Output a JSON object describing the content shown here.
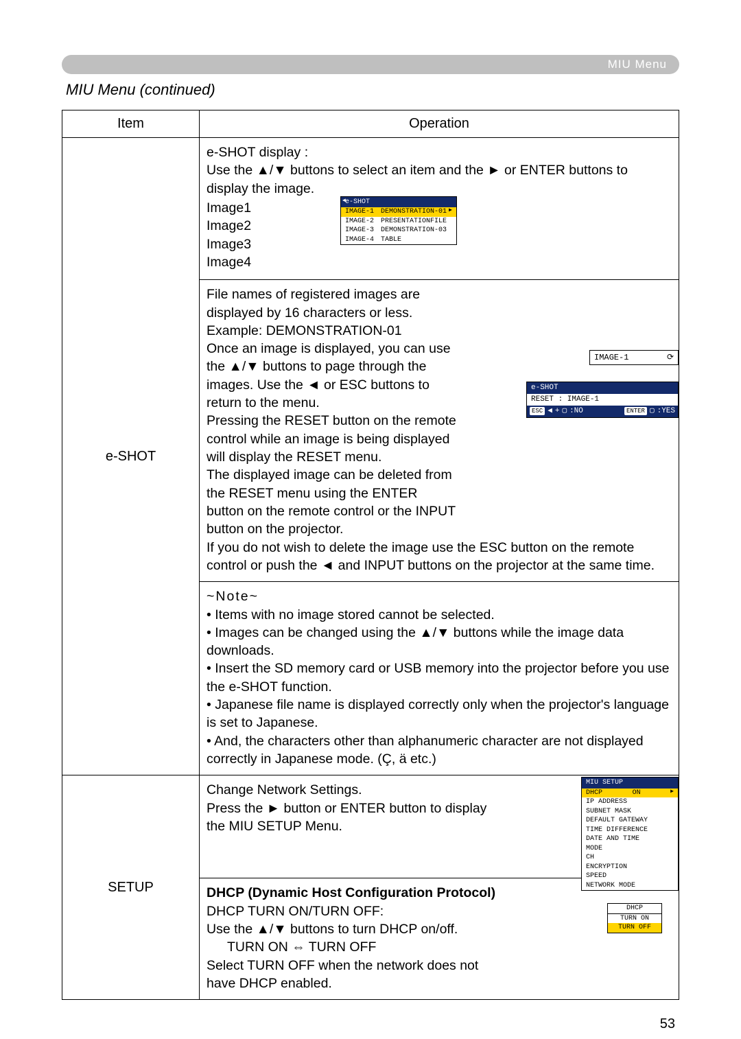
{
  "header": {
    "title": "MIU Menu"
  },
  "continued": "MIU Menu (continued)",
  "table": {
    "headers": {
      "item": "Item",
      "operation": "Operation"
    },
    "rows": {
      "eshot": {
        "item": "e-SHOT",
        "section1": {
          "title": "e-SHOT display :",
          "intro": "Use the ▲/▼ buttons to select an item and the ► or ENTER buttons to display the image.",
          "images": {
            "i1": "Image1",
            "i2": "Image2",
            "i3": "Image3",
            "i4": "Image4"
          },
          "menu": {
            "title": "e-SHOT",
            "r1l": "IMAGE-1",
            "r1r": "DEMONSTRATION-01",
            "r2l": "IMAGE-2",
            "r2r": "PRESENTATIONFILE",
            "r3l": "IMAGE-3",
            "r3r": "DEMONSTRATION-03",
            "r4l": "IMAGE-4",
            "r4r": "TABLE"
          }
        },
        "section2": {
          "para": "File names of registered images are displayed by 16 characters or less. Example: DEMONSTRATION-01\nOnce an image is displayed, you can use the ▲/▼ buttons to page through the images. Use the ◄ or ESC buttons to return to the menu.\nPressing the RESET button on the remote control while an image is being displayed will display the RESET menu.\nThe displayed image can be deleted from the RESET menu using the ENTER button on the remote control or the INPUT button on the projector.\nIf you do not wish to delete the image use the ESC button on the remote control or push the ◄ and INPUT buttons on the projector at the same time.",
          "image1_label": "IMAGE-1",
          "reset": {
            "t": "e-SHOT",
            "r": "RESET : IMAGE-1",
            "esc": "ESC",
            "no": ":NO",
            "enter": "ENTER",
            "yes": ":YES"
          }
        },
        "section3": {
          "heading": "~Note~",
          "b1": "• Items with no image stored cannot be selected.",
          "b2": "• Images can be changed using the ▲/▼ buttons while the image data downloads.",
          "b3": "• Insert the SD memory card or USB memory into the projector before you use the e-SHOT function.",
          "b4": "• Japanese file name is displayed correctly only when the projector's language is set to Japanese.",
          "b5": "• And, the characters other than alphanumeric character are not displayed correctly in Japanese mode. (Ç, ä etc.)"
        }
      },
      "setup": {
        "item": "SETUP",
        "upper": {
          "l1": "Change Network Settings.",
          "l2": "Press the ► button or ENTER button to display the MIU SETUP Menu.",
          "menu": {
            "title": "MIU SETUP",
            "dhcp": "DHCP",
            "dhcp_v": "ON",
            "ip": "IP ADDRESS",
            "subnet": "SUBNET MASK",
            "gw": "DEFAULT GATEWAY",
            "td": "TIME DIFFERENCE",
            "dt": "DATE AND TIME",
            "mode": "MODE",
            "ch": "CH",
            "enc": "ENCRYPTION",
            "speed": "SPEED",
            "nm": "NETWORK MODE"
          }
        },
        "lower": {
          "h": "DHCP (Dynamic Host Configuration Protocol)",
          "l1": "DHCP TURN ON/TURN OFF:",
          "l2": "Use the ▲/▼ buttons to turn DHCP on/off.",
          "l3": "TURN ON ⇔ TURN OFF",
          "l4": "Select TURN OFF when the network does not have DHCP enabled.",
          "box": {
            "t": "DHCP",
            "on": "TURN ON",
            "off": "TURN OFF"
          }
        }
      }
    }
  },
  "page": "53"
}
